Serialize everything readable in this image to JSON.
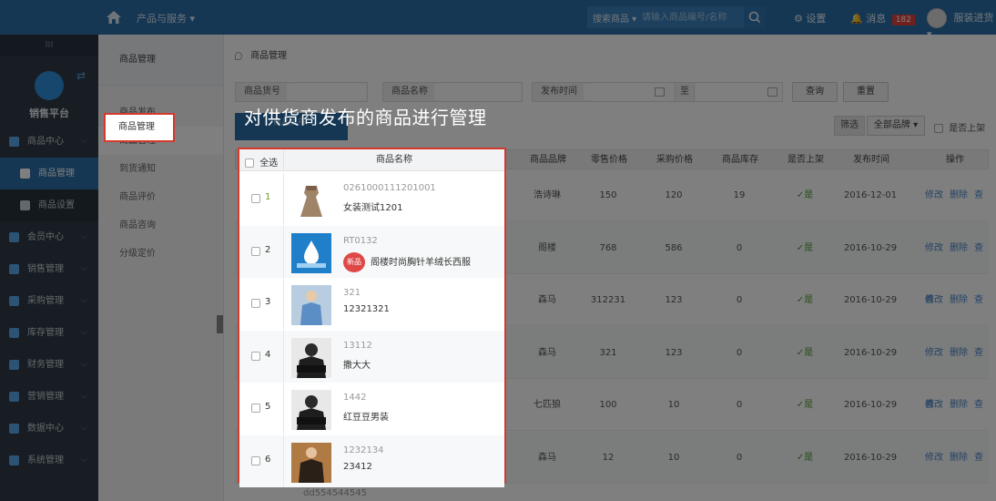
{
  "topbar": {
    "products_menu": "产品与服务 ▾",
    "search_type": "搜索商品 ▾",
    "search_placeholder": "请输入商品编号/名称",
    "settings": "设置",
    "messages": "消息",
    "message_count": "182",
    "user": "服装进货 ▾"
  },
  "sidebar": {
    "top": "III",
    "brand": "销售平台",
    "items": [
      {
        "label": "商品中心",
        "sub": false
      },
      {
        "label": "商品管理",
        "sub": true,
        "active": true
      },
      {
        "label": "商品设置",
        "sub": true
      },
      {
        "label": "会员中心",
        "sub": false
      },
      {
        "label": "销售管理",
        "sub": false
      },
      {
        "label": "采购管理",
        "sub": false
      },
      {
        "label": "库存管理",
        "sub": false
      },
      {
        "label": "财务管理",
        "sub": false
      },
      {
        "label": "营销管理",
        "sub": false
      },
      {
        "label": "数据中心",
        "sub": false
      },
      {
        "label": "系统管理",
        "sub": false
      }
    ]
  },
  "subside": {
    "title": "商品管理",
    "items": [
      "商品发布",
      "商品管理",
      "到货通知",
      "商品评价",
      "商品咨询",
      "分级定价"
    ]
  },
  "main": {
    "breadcrumb": "商品管理",
    "filters": {
      "code_label": "商品货号",
      "name_label": "商品名称",
      "time_label": "发布时间",
      "to_label": "至",
      "query": "查询",
      "reset": "重置"
    },
    "publish": "商品发布",
    "screen": "筛选",
    "all_brands": "全部品牌 ▾",
    "on_shelf": "是否上架",
    "columns": [
      "全选",
      "商品名称",
      "商品品牌",
      "零售价格",
      "采购价格",
      "商品库存",
      "是否上架",
      "发布时间",
      "操作"
    ],
    "ops": [
      "修改",
      "删除",
      "查看"
    ],
    "rows": [
      {
        "idx": "1",
        "code": "0261000111201001",
        "name": "女装测试1201",
        "brand": "浩诗琳",
        "retail": "150",
        "purchase": "120",
        "stock": "19",
        "on": "✓是",
        "date": "2016-12-01"
      },
      {
        "idx": "2",
        "code": "RT0132",
        "name": "阁楼时尚胸针羊绒长西服",
        "brand": "阁楼",
        "retail": "768",
        "purchase": "586",
        "stock": "0",
        "on": "✓是",
        "date": "2016-10-29",
        "tag": "新品"
      },
      {
        "idx": "3",
        "code": "321",
        "name": "12321321",
        "brand": "森马",
        "retail": "312231",
        "purchase": "123",
        "stock": "0",
        "on": "✓是",
        "date": "2016-10-29"
      },
      {
        "idx": "4",
        "code": "13112",
        "name": "撒大大",
        "brand": "森马",
        "retail": "321",
        "purchase": "123",
        "stock": "0",
        "on": "✓是",
        "date": "2016-10-29"
      },
      {
        "idx": "5",
        "code": "1442",
        "name": "红豆豆男装",
        "brand": "七匹狼",
        "retail": "100",
        "purchase": "10",
        "stock": "0",
        "on": "✓是",
        "date": "2016-10-29"
      },
      {
        "idx": "6",
        "code": "1232134",
        "name": "23412",
        "brand": "森马",
        "retail": "12",
        "purchase": "10",
        "stock": "0",
        "on": "✓是",
        "date": "2016-10-29"
      }
    ],
    "next_code": "dd554544545"
  },
  "overlay": {
    "caption": "对供货商发布的商品进行管理",
    "highlight_label": "商品管理"
  }
}
